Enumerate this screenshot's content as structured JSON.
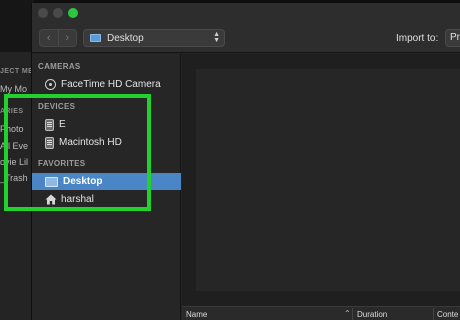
{
  "background_app": {
    "lines": [
      "JECT ME",
      "My Mo",
      "ARIES",
      "Photo",
      "All Eve",
      "ovie Lil",
      "_Trash"
    ]
  },
  "dialog": {
    "toolbar": {
      "back_icon": "chevron-left-icon",
      "forward_icon": "chevron-right-icon",
      "location": "Desktop",
      "import_label": "Import to:",
      "import_value": "Pr"
    },
    "sidebar": {
      "cameras_header": "CAMERAS",
      "camera_item": "FaceTime HD Camera",
      "devices_header": "DEVICES",
      "device_items": [
        "E",
        "Macintosh HD"
      ],
      "favorites_header": "FAVORITES",
      "favorite_items": [
        "Desktop",
        "harshal"
      ],
      "selected": "Desktop"
    },
    "list_header": {
      "name": "Name",
      "sort_glyph": "⌃",
      "duration": "Duration",
      "content": "Conte"
    }
  },
  "colors": {
    "selection": "#4a86c6",
    "highlight": "#22d12b",
    "zoom_light": "#2cc840"
  }
}
